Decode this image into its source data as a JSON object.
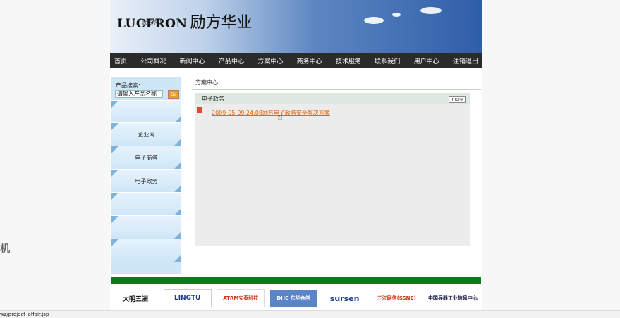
{
  "header": {
    "logo_en": "Lucfron",
    "logo_cn": "励方华业",
    "logo_sub": "励方华业"
  },
  "nav": {
    "items": [
      "首页",
      "公司概况",
      "新闻中心",
      "产品中心",
      "方案中心",
      "商务中心",
      "技术服务",
      "联系我们",
      "用户中心",
      "注销退出"
    ]
  },
  "sidebar": {
    "search_label": "产品搜索:",
    "search_value": "请输入产品名称",
    "go_label": "Go",
    "items": [
      "企业网",
      "电子商务",
      "电子政务"
    ]
  },
  "content": {
    "title": "方案中心",
    "panel_title": "电子政务",
    "more_label": "more",
    "article": "2009-05-09.24.08励方电子政务安全解决方案"
  },
  "partners": [
    "大明五洲",
    "LINGTU",
    "ATRM安泰科技",
    "DHC 东华合创",
    "sursen",
    "三江网信(SSNC)",
    "中国兵器工业信息中心"
  ],
  "side_mark": "机",
  "status": {
    "url": "wz/project_affair.jsp"
  },
  "colors": {
    "nav_bg": "#2b2b2b",
    "accent_green": "#0a7d19",
    "sidebar_bg": "#cfe6f7",
    "link": "#e06a10"
  }
}
